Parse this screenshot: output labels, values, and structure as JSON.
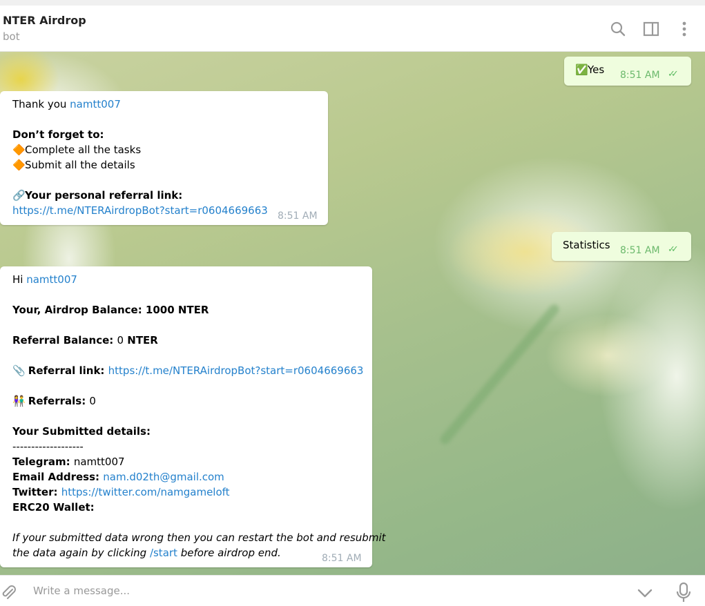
{
  "header": {
    "title": "NTER Airdrop",
    "subtitle": "bot"
  },
  "messages": {
    "yes": {
      "emoji": "✅",
      "text": "Yes",
      "time": "8:51 AM"
    },
    "thanks": {
      "greeting": "Thank you ",
      "username": "namtt007",
      "dont_forget": "Don’t forget to:",
      "task1_icon": "🔶",
      "task1": "Complete all the tasks",
      "task2_icon": "🔶",
      "task2": "Submit all the details",
      "ref_icon": "🔗",
      "ref_label": "Your personal referral link:",
      "ref_link": "https://t.me/NTERAirdropBot?start=r0604669663",
      "time": "8:51 AM"
    },
    "statistics": {
      "text": "Statistics",
      "time": "8:51 AM"
    },
    "stats": {
      "hi": "Hi ",
      "username": "namtt007",
      "balance": "Your, Airdrop Balance: 1000 NTER",
      "ref_balance_label": "Referral Balance: ",
      "ref_balance_value": "0",
      "ref_balance_unit": " NTER",
      "ref_link_icon": "📎",
      "ref_link_label": "Referral link: ",
      "ref_link": "https://t.me/NTERAirdropBot?start=r0604669663",
      "referrals_icon": "👫",
      "referrals_label": "Referrals: ",
      "referrals_value": "0",
      "submitted_title": "Your Submitted details:",
      "divider": "-------------------",
      "telegram_label": "Telegram: ",
      "telegram_value": "namtt007",
      "email_label": "Email Address: ",
      "email_value": "nam.d02th@gmail.com",
      "twitter_label": "Twitter: ",
      "twitter_value": "https://twitter.com/namgameloft",
      "wallet_label": "ERC20 Wallet:",
      "note_part1": "If your submitted data wrong then you can restart the bot and resubmit",
      "note_part2": "the data again by clicking ",
      "note_cmd": "/start",
      "note_part3": " before airdrop end.",
      "time": "8:51 AM"
    }
  },
  "composer": {
    "placeholder": "Write a message..."
  },
  "icons": [
    "search-icon",
    "sidebar-toggle-icon",
    "more-vertical-icon",
    "attach-icon",
    "chevron-down-icon",
    "microphone-icon"
  ],
  "colors": {
    "link": "#2481cc",
    "outgoing_bubble": "#effdde",
    "read_ticks": "#5dbb62"
  }
}
